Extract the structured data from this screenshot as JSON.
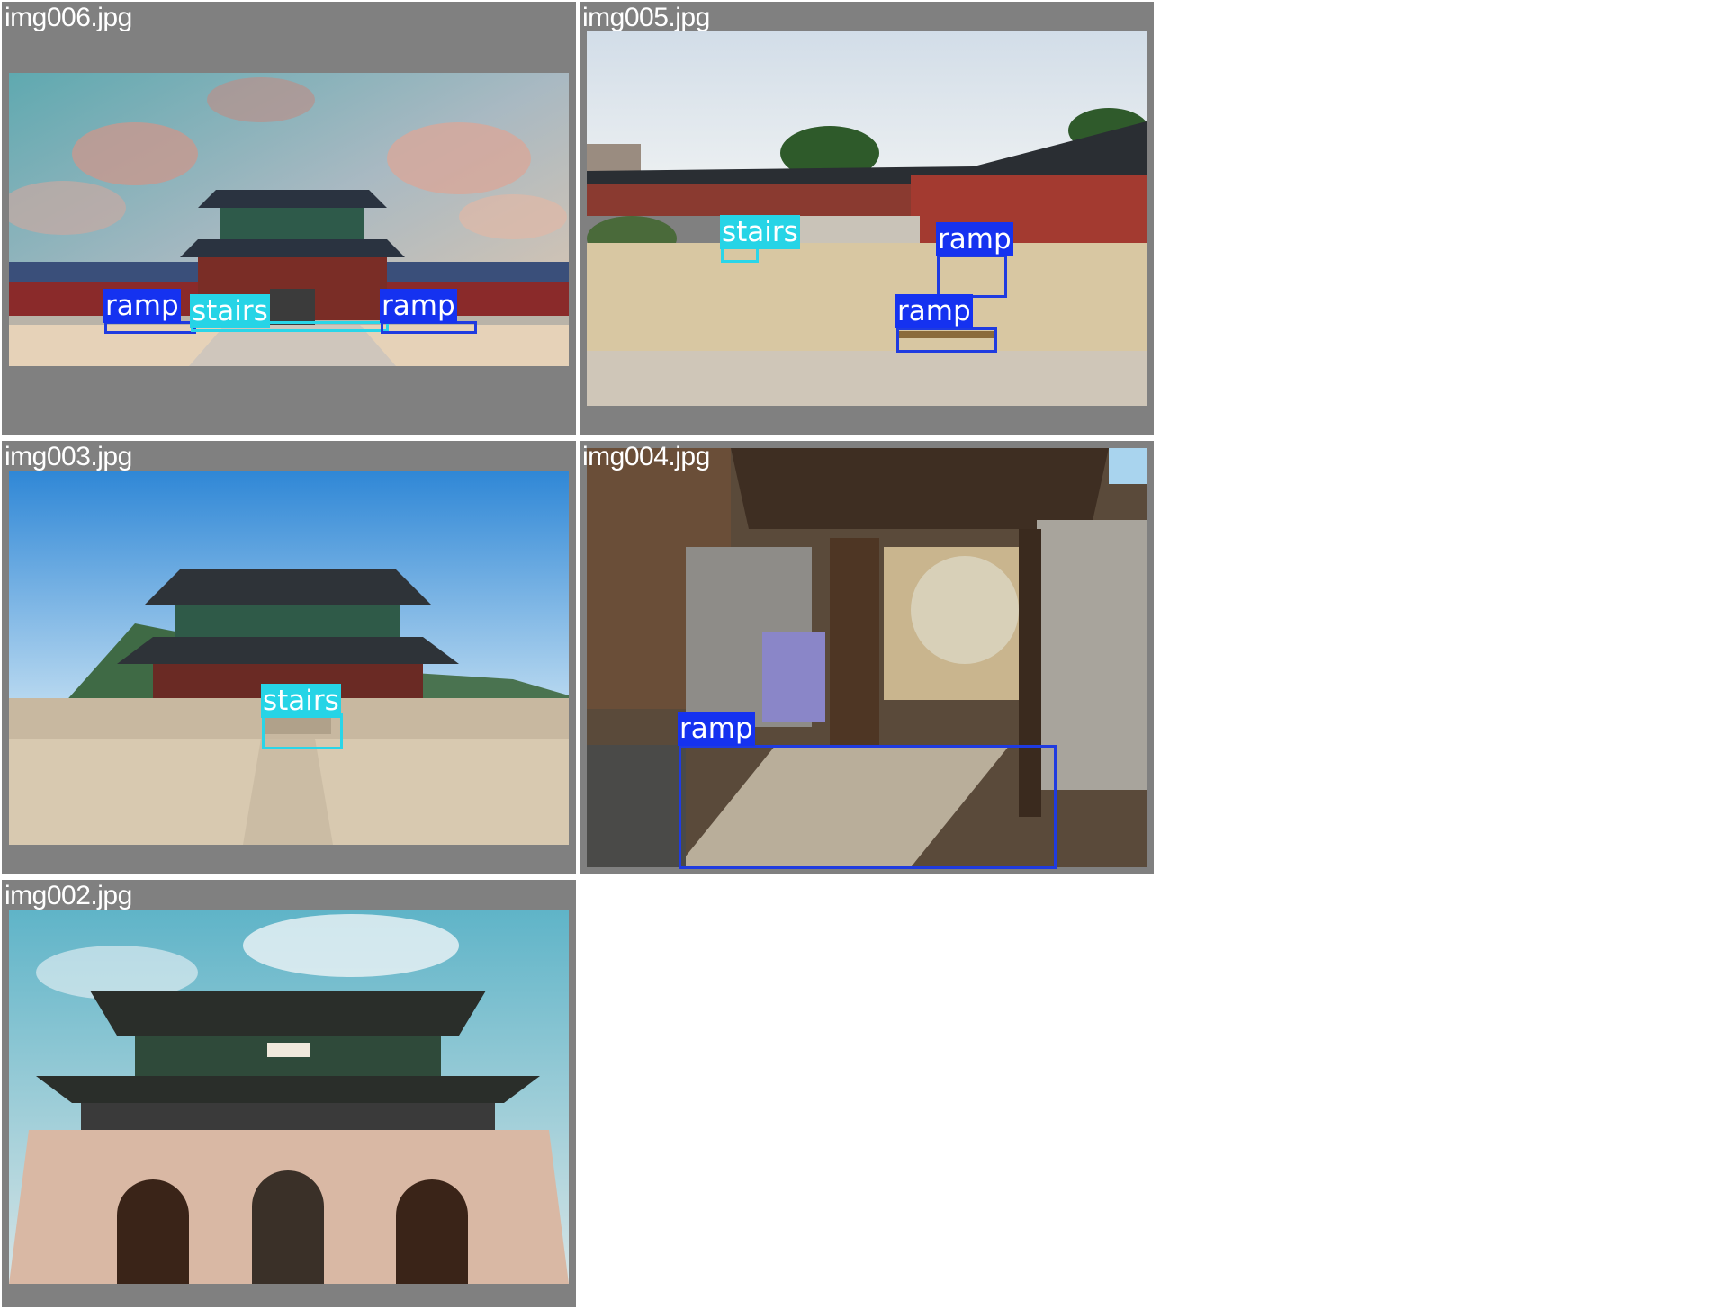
{
  "tiles": [
    {
      "filename": "img006.jpg",
      "detections": [
        {
          "label": "ramp"
        },
        {
          "label": "stairs"
        },
        {
          "label": "ramp"
        }
      ]
    },
    {
      "filename": "img005.jpg",
      "detections": [
        {
          "label": "stairs"
        },
        {
          "label": "ramp"
        },
        {
          "label": "ramp"
        }
      ]
    },
    {
      "filename": "img003.jpg",
      "detections": [
        {
          "label": "stairs"
        }
      ]
    },
    {
      "filename": "img004.jpg",
      "detections": [
        {
          "label": "ramp"
        }
      ]
    },
    {
      "filename": "img002.jpg",
      "detections": []
    }
  ],
  "colors": {
    "tile_background": "#808080",
    "ramp": "#1532f0",
    "stairs": "#26d4e6"
  }
}
